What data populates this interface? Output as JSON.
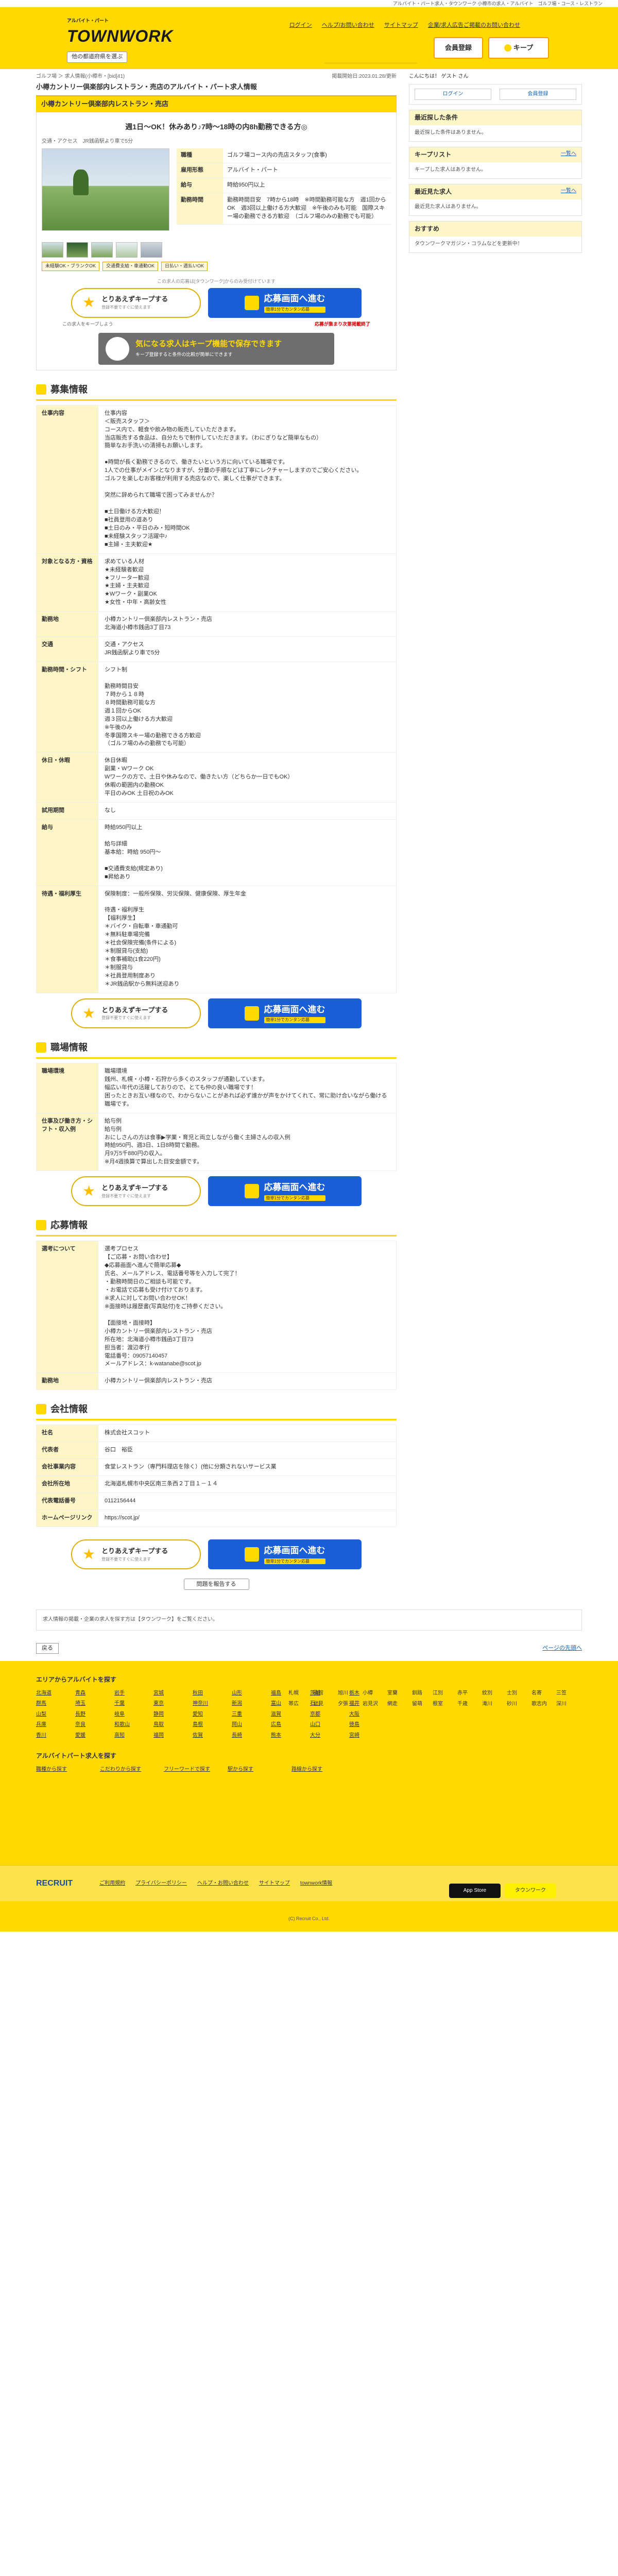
{
  "topline": "アルバイト・パート求人・タウンワーク  小樽市の求人・アルバイト　ゴルフ場・コース・レストラン",
  "header": {
    "logo": "TOWNWORK",
    "logo_sub": "アルバイト・パート",
    "region": "他の都道府県を選ぶ",
    "links": [
      "ログイン",
      "ヘルプ/お問い合わせ",
      "サイトマップ",
      "企業/求人広告ご掲載のお問い合わせ"
    ],
    "register": "会員登録",
    "keep": "キープ"
  },
  "breadcrumb": "ゴルフ場 ＞ 求人情報(小樽市・[bid]41)",
  "posted": "掲載開始日:2023.01.28/更新",
  "job": {
    "company": "小樽カントリー倶楽部内レストラン・売店のアルバイト・パート求人情報",
    "tab": "小樽カントリー倶楽部内レストラン・売店",
    "catch": "週1日〜OK！休みあり♪7時〜18時の内8h勤務できる方◎",
    "traffic": "交通・アクセス　JR銭函駅より車で5分",
    "info": [
      {
        "k": "職種",
        "v": "ゴルフ場コース内の売店スタッフ(食事)"
      },
      {
        "k": "雇用形態",
        "v": "アルバイト・パート"
      },
      {
        "k": "給与",
        "v": "時給950円以上"
      },
      {
        "k": "勤務時間",
        "v": "勤務時間目安　7時から18時　※時間勤務可能な方　週1回からOK　週3回以上働ける方大歓迎　※午後のみも可能　国際スキー場の勤務できる方歓迎　（ゴルフ場のみの勤務でも可能）"
      }
    ],
    "tags": [
      "未経験OK・ブランクOK",
      "交通費支給・車通勤OK",
      "日払い・週払いOK"
    ],
    "note": "この求人の応募は[タウンワーク]からのみ受付けています"
  },
  "cta": {
    "keep": "とりあえずキープする",
    "keep_sub": "登録不要ですぐに使えます",
    "apply": "応募画面へ進む",
    "apply_sub": "簡単1分でカンタン応募",
    "left_note": "この求人をキープしよう",
    "right_note": "応募が集まり次第掲載終了",
    "right_sub": "この求人の応募は早めがおすすめ"
  },
  "banner": {
    "title": "気になる求人はキープ機能で保存できます",
    "sub": "キープ登録すると条件の比較が簡単にできます"
  },
  "sections": {
    "recruit": "募集情報",
    "workplace": "職場情報",
    "apply": "応募情報",
    "company": "会社情報"
  },
  "recruit_rows": [
    {
      "k": "仕事内容",
      "v": "仕事内容\n＜販売スタッフ＞\nコース内で、軽食や飲み物の販売していただきます。\n当店販売する食品は、自分たちで制作していただきます。（わにぎりなど簡単なもの）\n簡単なお手洗いの清掃もお願いします。\n\n●時間が長く勤務できるので、働きたいという方に向いている職場です。\n1人での仕事がメインとなりますが、分量の手順などは丁寧にレクチャーしますのでご安心ください。\nゴルフを楽しむお客様が利用する売店なので、楽しく仕事ができます。\n\n突然に辞められて職場で困ってみませんか？\n\n■土日働ける方大歓迎！\n■社員登用の道あり\n■土日のみ・平日のみ・短時間OK\n■未経験スタッフ活躍中♪\n■主婦・主夫歓迎★"
    },
    {
      "k": "対象となる方・資格",
      "v": "求めている人材\n★未経験者歓迎\n★フリーター歓迎\n★主婦・主夫歓迎\n★Wワーク・副業OK\n★女性・中年・高齢女性"
    },
    {
      "k": "勤務地",
      "v": "小樽カントリー倶楽部内レストラン・売店\n北海道小樽市銭函3丁目73"
    },
    {
      "k": "交通",
      "v": "交通・アクセス\nJR銭函駅より車で5分"
    },
    {
      "k": "勤務時間・シフト",
      "v": "シフト制\n\n勤務時間目安\n７時から１８時\n８時間勤務可能な方\n週１回からOK\n週３回以上働ける方大歓迎\n※午後のみ\n冬季国際スキー場の勤務できる方歓迎\n（ゴルフ場のみの勤務でも可能）"
    },
    {
      "k": "休日・休暇",
      "v": "休日休暇\n副業・Wワーク OK\nWワークの方で、土日や休みなので、働きたい方（どちらか一日でもOK）\n休暇の範囲内の勤務OK\n平日のみOK 土日祝のみOK"
    },
    {
      "k": "試用期間",
      "v": "なし"
    },
    {
      "k": "給与",
      "v": "時給950円以上\n\n給与詳細\n基本給：時給 950円〜\n\n■交通費支給(規定あり)\n■昇給あり"
    },
    {
      "k": "待遇・福利厚生",
      "v": "保険制度：一般所保険、労災保険、健康保険、厚生年金\n\n待遇・福利厚生\n【福利厚生】\n＊バイク・自転車・車通勤可\n＊無料駐車場完備\n＊社会保険完備(条件による)\n＊制服貸与(支給)\n＊食事補助(1食220円)\n＊制服貸与\n＊社員登用制度あり\n＊JR銭函駅から無料送迎あり"
    }
  ],
  "workplace_rows": [
    {
      "k": "職場環境",
      "v": "職場環境\n銭州、札幌・小樽・石狩から多くのスタッフが通勤しています。\n幅広い年代の活躍しておりので、とても仲の良い職場です！\n困ったときお互い様なので、わからないことがあれば必ず誰かが声をかけてくれて、常に助け合いながら働ける職場です。"
    },
    {
      "k": "仕事及び働き方・シフト・収入例",
      "v": "給与例\n給与例\nおにしさんの方は食事▶学業・育児と両立しながら働く主婦さんの収入例\n時給950円、週3日、1日8時間で勤務。\n月9万5千880円の収入。\n※月4週換算で算出した目安金額です。"
    }
  ],
  "apply_rows": [
    {
      "k": "選考について",
      "v": "選考プロセス\n【ご応募・お問い合わせ】\n◆応募画面へ進んで簡単応募◆\n氏名、メールアドレス、電話番号等を入力して完了！\n・勤務時間日のご相談も可能です。\n・お電話で応募も受け付けております。\n※求人に対してお問い合わせOK！\n※面接時は履歴書(写真貼付)をご持参ください。\n\n【面接地・面接時】\n小樽カントリー倶楽部内レストラン・売店\n所在地：北海道小樽市銭函3丁目73\n担当者：渡辺孝行\n電話番号：09057140457\nメールアドレス：k-watanabe@scot.jp"
    },
    {
      "k": "勤務地",
      "v": "小樽カントリー倶楽部内レストラン・売店"
    }
  ],
  "company_rows": [
    {
      "k": "社名",
      "v": "株式会社スコット"
    },
    {
      "k": "代表者",
      "v": "谷口　裕臣"
    },
    {
      "k": "会社事業内容",
      "v": "食堂レストラン（専門料理店を除く）(他に分類されないサービス業"
    },
    {
      "k": "会社所在地",
      "v": "北海道札幌市中央区南三条西２丁目１－１４"
    },
    {
      "k": "代表電話番号",
      "v": "0112156444"
    },
    {
      "k": "ホームページリンク",
      "v": "https://scot.jp/"
    }
  ],
  "report": "問題を報告する",
  "side": {
    "greet": "こんにちは！ ゲスト さん",
    "login": "ログイン",
    "register": "会員登録",
    "recent_search": "最近探した条件",
    "recent_search_body": "最近探した条件はありません。",
    "keep_list": "キープリスト",
    "keep_list_body": "キープした求人はありません。",
    "recent_view": "最近見た求人",
    "recent_view_body": "最近見た求人はありません。",
    "more": "一覧へ",
    "osusume": "おすすめ",
    "osusume_body": "タウンワークマガジン・コラムなどを更新中！"
  },
  "bottom_notice": "求人情報の掲載・企業の求人を探す方は【タウンワーク】をご覧ください。",
  "back": "戻る",
  "pagetop": "ページの先頭へ",
  "footer": {
    "title": "エリアからアルバイトを探す",
    "areas_left": [
      "北海道",
      "青森",
      "岩手",
      "宮城",
      "秋田",
      "山形",
      "福島",
      "茨城",
      "栃木",
      "群馬",
      "埼玉",
      "千葉",
      "東京",
      "神奈川",
      "新潟",
      "富山",
      "石川",
      "福井",
      "山梨",
      "長野",
      "岐阜",
      "静岡",
      "愛知",
      "三重",
      "滋賀",
      "京都",
      "大阪",
      "兵庫",
      "奈良",
      "和歌山",
      "鳥取",
      "島根",
      "岡山",
      "広島",
      "山口",
      "徳島",
      "香川",
      "愛媛",
      "高知",
      "福岡",
      "佐賀",
      "長崎",
      "熊本",
      "大分",
      "宮崎"
    ],
    "areas_mid": [
      "札幌",
      "函館",
      "旭川",
      "小樽",
      "室蘭",
      "釧路",
      "帯広",
      "北見",
      "夕張",
      "岩見沢",
      "網走",
      "留萌"
    ],
    "areas_right": [
      "江別",
      "赤平",
      "紋別",
      "士別",
      "名寄",
      "三笠",
      "根室",
      "千歳",
      "滝川",
      "砂川",
      "歌志内",
      "深川"
    ],
    "lower_title": "アルバイトパート求人を探す",
    "lower_links": [
      "職種から探す",
      "こだわりから探す",
      "フリーワードで探す",
      "駅から探す",
      "路線から探す"
    ],
    "recruit": "RECRUIT",
    "bar_links": [
      "ご利用規約",
      "プライバシーポリシー",
      "ヘルプ・お問い合わせ",
      "サイトマップ",
      "townwork情報"
    ],
    "apps": [
      "App Store",
      "タウンワーク"
    ],
    "copyright": "(C) Recruit Co., Ltd."
  }
}
